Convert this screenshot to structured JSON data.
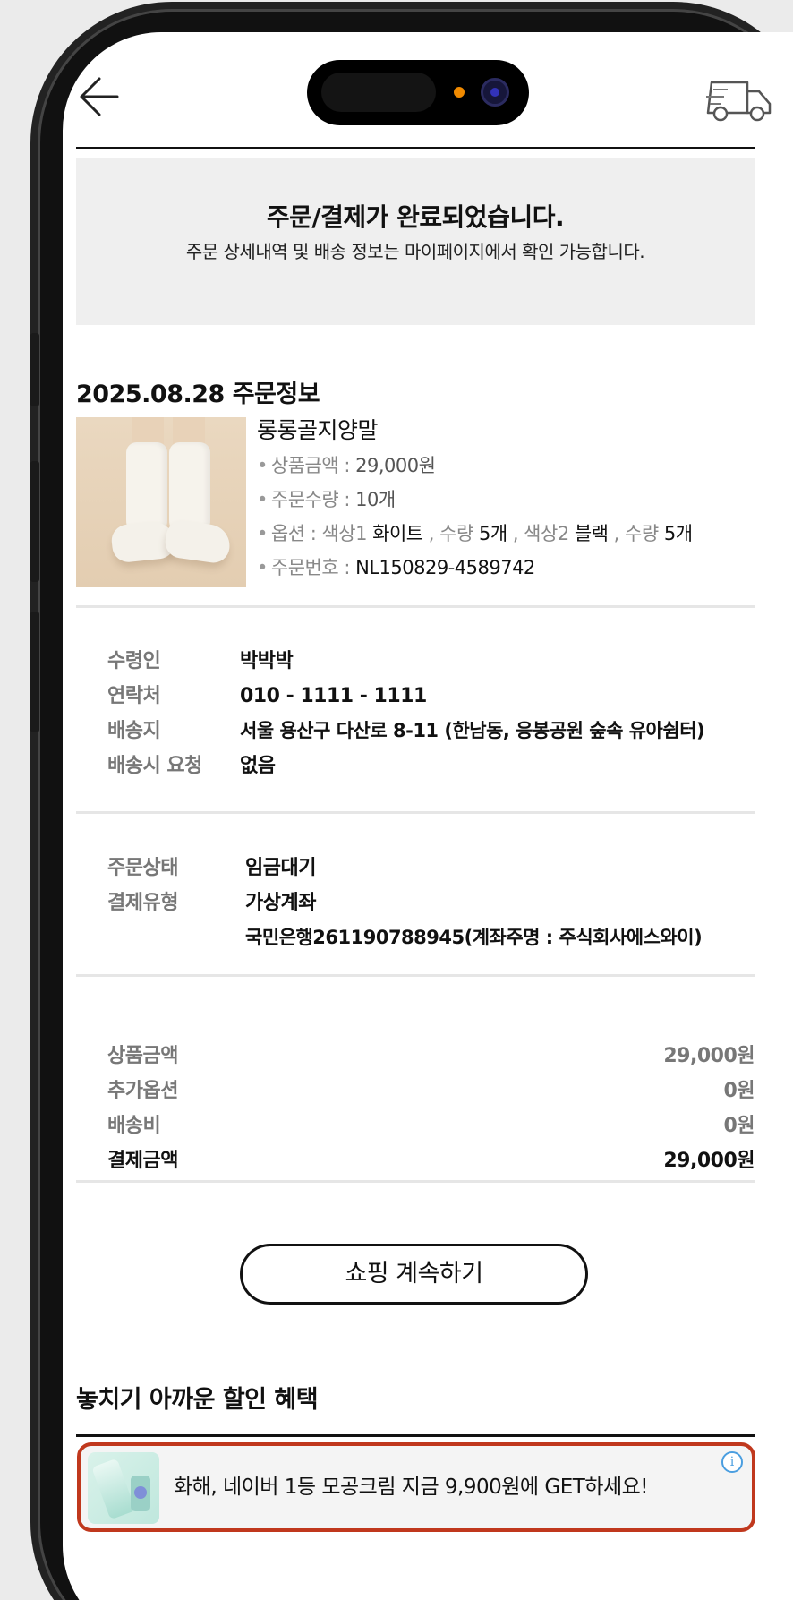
{
  "notice": {
    "title": "주문/결제가 완료되었습니다.",
    "subtitle": "주문 상세내역 및 배송 정보는 마이페이지에서 확인 가능합니다."
  },
  "order": {
    "heading": "2025.08.28 주문정보",
    "product_name": "롱롱골지양말",
    "price_label": "상품금액 : ",
    "price_value": "29,000원",
    "qty_label": "주문수량 : ",
    "qty_value": "10개",
    "option_label": "옵션 : ",
    "option_color1_label": "색상1 ",
    "option_color1_value": "화이트",
    "option_sep1": " , 수량 ",
    "option_qty1": "5개",
    "option_sep2": " , 색상2 ",
    "option_color2_value": "블랙",
    "option_sep3": " , 수량 ",
    "option_qty2": "5개",
    "order_no_label": "주문번호 : ",
    "order_no_value": "NL150829-4589742"
  },
  "recipient": {
    "name_label": "수령인",
    "name_value": "박박박",
    "phone_label": "연락처",
    "phone_value": "010 - 1111 - 1111",
    "address_label": "배송지",
    "address_value": "서울 용산구 다산로 8-11 (한남동, 응봉공원 숲속 유아쉼터)",
    "request_label": "배송시 요청",
    "request_value": "없음"
  },
  "payment": {
    "status_label": "주문상태",
    "status_value": "임금대기",
    "type_label": "결제유형",
    "type_value": "가상계좌",
    "account_value": "국민은행261190788945(계좌주명 : 주식회사에스와이)"
  },
  "summary": {
    "product_label": "상품금액",
    "product_value": "29,000원",
    "option_label": "추가옵션",
    "option_value": "0원",
    "shipping_label": "배송비",
    "shipping_value": "0원",
    "total_label": "결제금액",
    "total_value": "29,000원"
  },
  "continue_button": "쇼핑 계속하기",
  "benefit": {
    "title": "놓치기 아까운 할인 혜택"
  },
  "ad": {
    "text": "화해, 네이버 1등 모공크림 지금 9,900원에 GET하세요!",
    "info_glyph": "i",
    "highlight_color": "#c0381d"
  },
  "icons": {
    "back": "back-arrow-icon",
    "delivery": "delivery-truck-icon"
  }
}
